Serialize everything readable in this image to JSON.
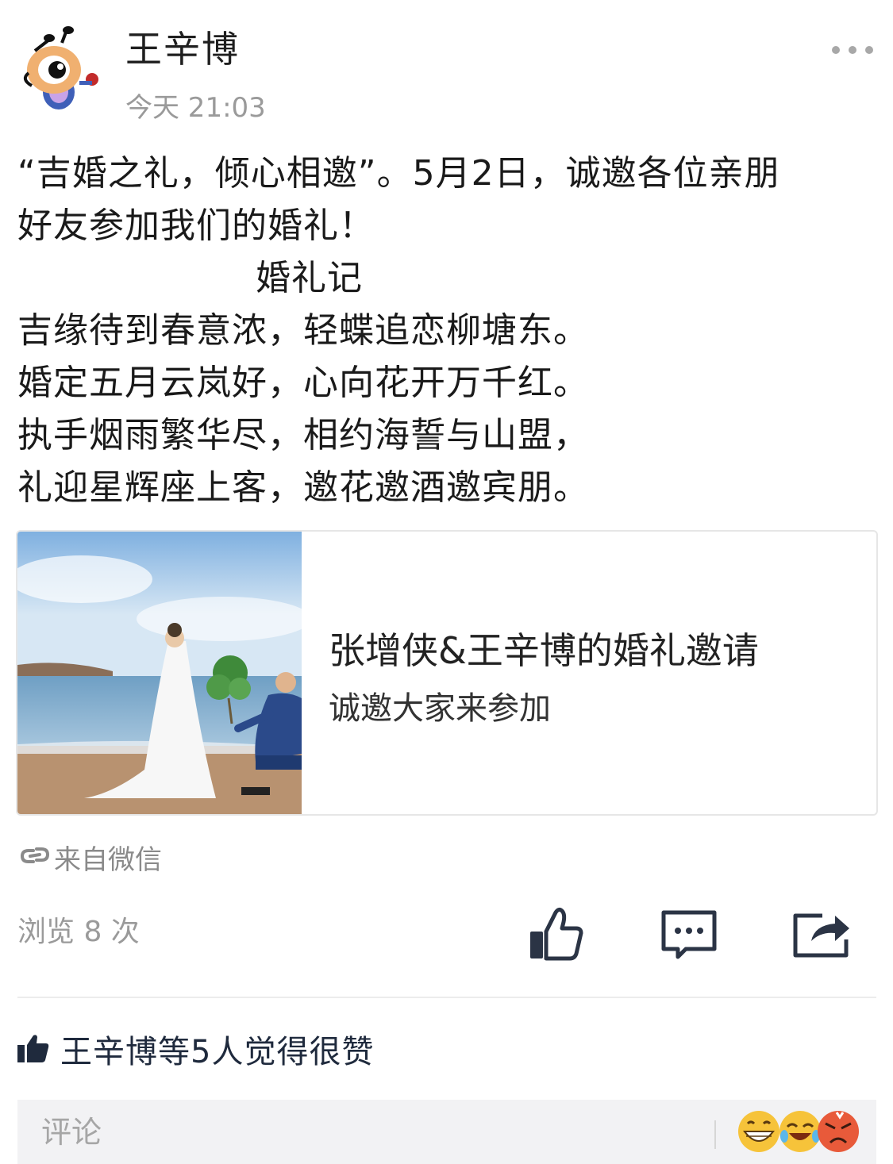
{
  "post": {
    "author": "王辛博",
    "time": "今天 21:03",
    "body_lines": [
      "“吉婚之礼，倾心相邀”。5月2日，诚邀各位亲朋",
      "好友参加我们的婚礼！",
      "婚礼记",
      "吉缘待到春意浓，轻蝶追恋柳塘东。",
      "婚定五月云岚好，心向花开万千红。",
      "执手烟雨繁华尽，相约海誓与山盟，",
      "礼迎星辉座上客，邀花邀酒邀宾朋。"
    ]
  },
  "card": {
    "title": "张增侠&王辛博的婚礼邀请",
    "subtitle": "诚邀大家来参加"
  },
  "source": {
    "text": "来自微信",
    "icon": "link-icon"
  },
  "stats": {
    "views": "浏览 8 次"
  },
  "actions": {
    "like_icon": "thumbs-up-icon",
    "comment_icon": "comment-icon",
    "share_icon": "share-icon"
  },
  "likes": {
    "text": "王辛博等5人觉得很赞",
    "icon": "thumbs-up-icon"
  },
  "comment_bar": {
    "placeholder": "评论",
    "emojis": [
      "grin-emoji",
      "laugh-tears-emoji",
      "angry-emoji"
    ]
  },
  "colors": {
    "text": "#1a1a1a",
    "secondary": "#9a9a9a",
    "icon_dark": "#2b3445",
    "likes_blue": "#1f2a3d",
    "comment_bg": "#f2f2f4"
  }
}
